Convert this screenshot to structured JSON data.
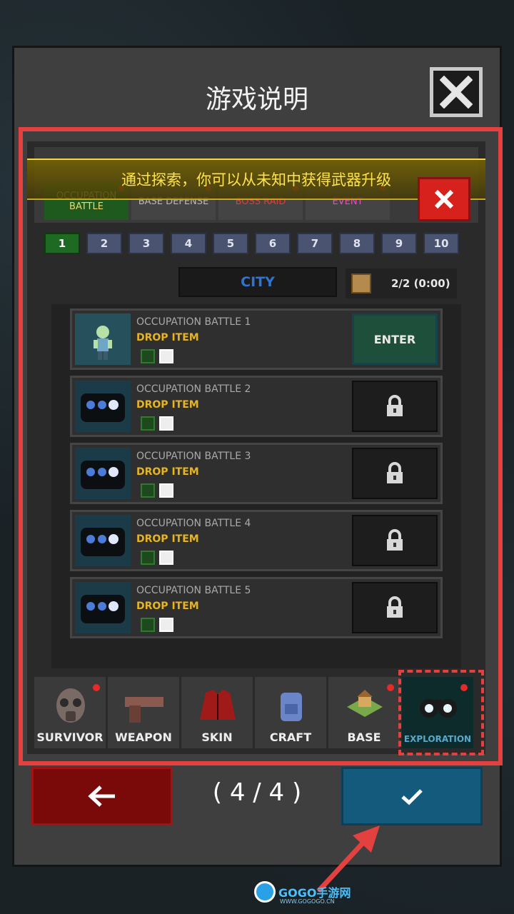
{
  "dialog": {
    "title": "游戏说明",
    "page_indicator": "( 4 / 4 )"
  },
  "game": {
    "tip": "通过探索，你可以从未知中获得武器升级",
    "mode_tabs": [
      {
        "label": "OCCUPATION BATTLE",
        "color": "#f5d36b",
        "active": true
      },
      {
        "label": "BASE DEFENSE",
        "color": "#b8b8b8",
        "active": false
      },
      {
        "label": "BOSS RAID",
        "color": "#e23b3b",
        "active": false
      },
      {
        "label": "EVENT",
        "color": "#e84cc4",
        "active": false
      }
    ],
    "pages": [
      "1",
      "2",
      "3",
      "4",
      "5",
      "6",
      "7",
      "8",
      "9",
      "10"
    ],
    "active_page": "1",
    "region": "CITY",
    "tickets": "2/2 (0:00)",
    "battles": [
      {
        "name": "OCCUPATION BATTLE 1",
        "drop": "DROP ITEM",
        "action": "ENTER",
        "locked": false
      },
      {
        "name": "OCCUPATION BATTLE 2",
        "drop": "DROP ITEM",
        "action": "",
        "locked": true
      },
      {
        "name": "OCCUPATION BATTLE 3",
        "drop": "DROP ITEM",
        "action": "",
        "locked": true
      },
      {
        "name": "OCCUPATION BATTLE 4",
        "drop": "DROP ITEM",
        "action": "",
        "locked": true
      },
      {
        "name": "OCCUPATION BATTLE 5",
        "drop": "DROP ITEM",
        "action": "",
        "locked": true
      }
    ],
    "categories": [
      {
        "label": "SURVIVOR",
        "icon": "gas-mask-icon",
        "dot": true
      },
      {
        "label": "WEAPON",
        "icon": "pistol-icon",
        "dot": false
      },
      {
        "label": "SKIN",
        "icon": "jacket-icon",
        "dot": false
      },
      {
        "label": "CRAFT",
        "icon": "backpack-icon",
        "dot": false
      },
      {
        "label": "BASE",
        "icon": "house-icon",
        "dot": true
      },
      {
        "label": "EXPLORATION",
        "icon": "binoculars-icon",
        "dot": true,
        "active": true
      }
    ]
  },
  "colors": {
    "highlight": "#e2413f",
    "back_button": "#7a0a0a",
    "confirm_button": "#135a7c"
  },
  "watermark": {
    "name": "GOGO手游网",
    "url": "WWW.GOGOGO.CN"
  }
}
